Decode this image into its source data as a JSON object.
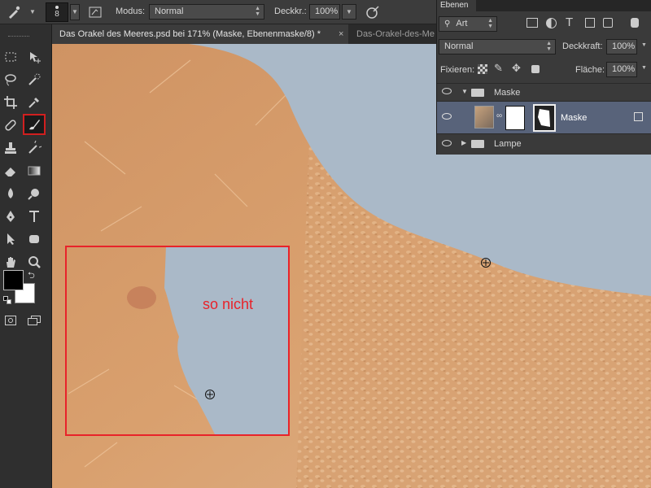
{
  "options_bar": {
    "brush_size": "8",
    "mode_label": "Modus:",
    "mode_value": "Normal",
    "opacity_label": "Deckkr.:",
    "opacity_value": "100%"
  },
  "tabs": [
    {
      "label": "Das Orakel des Meeres.psd bei 171% (Maske, Ebenenmaske/8) *",
      "close": "×"
    },
    {
      "label": "Das-Orakel-des-Me"
    }
  ],
  "layers_panel": {
    "title": "Ebenen",
    "filter_value": "Art",
    "blend_mode": "Normal",
    "opacity_label": "Deckkraft:",
    "opacity_value": "100%",
    "lock_label": "Fixieren:",
    "fill_label": "Fläche:",
    "fill_value": "100%",
    "layers": [
      {
        "name": "Maske",
        "kind": "group",
        "expanded": true
      },
      {
        "name": "Maske",
        "kind": "layer",
        "selected": true
      },
      {
        "name": "Lampe",
        "kind": "group",
        "expanded": false
      }
    ]
  },
  "canvas": {
    "annotation_text": "so nicht",
    "annotation_color": "#e8232a",
    "skin_color": "#d9a06e",
    "mask_color": "#a9b8c7"
  },
  "colors": {
    "foreground": "#000000",
    "background": "#ffffff",
    "highlight_border": "#d11f1f"
  }
}
